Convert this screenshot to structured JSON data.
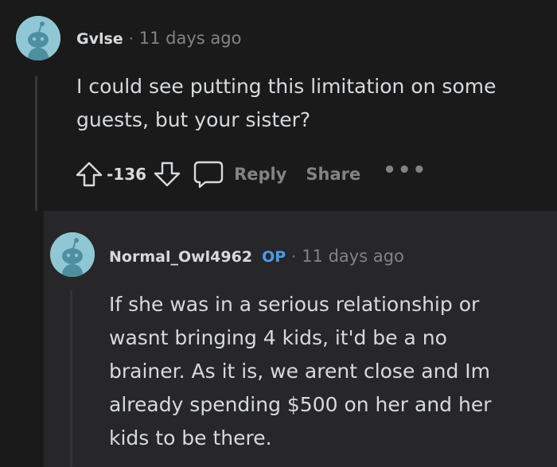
{
  "comment": {
    "username": "Gvlse",
    "separator": "·",
    "time": "11 days ago",
    "body_line1": "I could see putting this limitation on some",
    "body_line2": "guests, but your sister?",
    "score": "-136",
    "reply_label": "Reply",
    "share_label": "Share",
    "more_label": "•••"
  },
  "reply": {
    "username": "Normal_Owl4962",
    "op_badge": "OP",
    "separator": "·",
    "time": "11 days ago",
    "body_line1": "If she was in a serious relationship or",
    "body_line2": "wasnt bringing 4 kids, it'd be a no",
    "body_line3": "brainer. As it is, we arent close and Im",
    "body_line4": "already spending $500 on her and her",
    "body_line5": "kids to be there."
  },
  "icons": {
    "avatar": "reddit-snoo-avatar-icon",
    "upvote": "upvote-arrow-icon",
    "downvote": "downvote-arrow-icon",
    "reply": "speech-bubble-icon"
  },
  "colors": {
    "background": "#1a1a1b",
    "nested_background": "#272729",
    "text": "#d7dadc",
    "muted": "#818384",
    "op_badge": "#4a9bea",
    "avatar_bg": "#8fc8d4"
  }
}
